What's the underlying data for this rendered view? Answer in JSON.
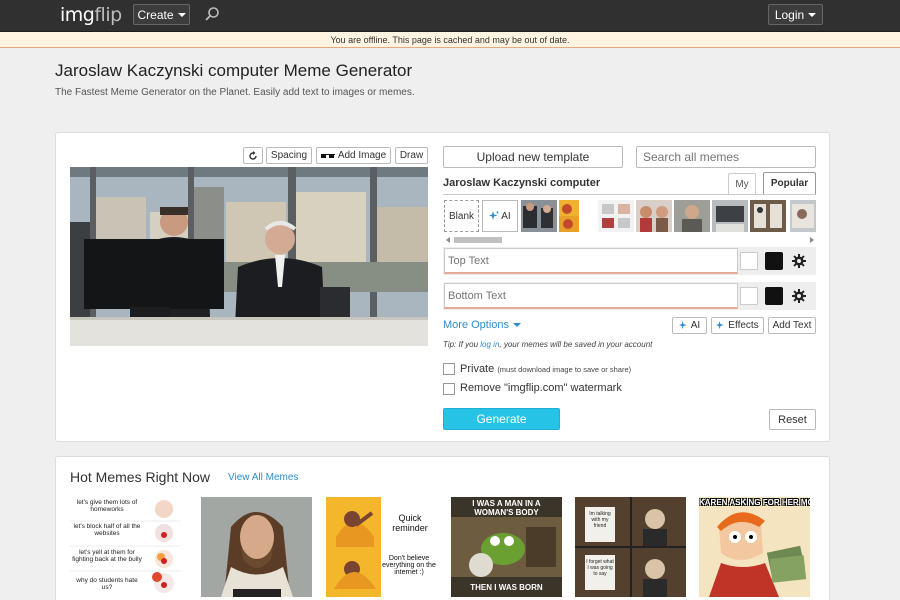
{
  "topbar": {
    "logo_primary": "img",
    "logo_secondary": "flip",
    "create_label": "Create",
    "login_label": "Login"
  },
  "offline_banner": "You are offline. This page is cached and may be out of date.",
  "page": {
    "title": "Jaroslaw Kaczynski computer Meme Generator",
    "subtitle": "The Fastest Meme Generator on the Planet. Easily add text to images or memes."
  },
  "toolbar": {
    "rotate_icon": "rotate-icon",
    "spacing_label": "Spacing",
    "add_image_label": "Add Image",
    "draw_label": "Draw"
  },
  "editor": {
    "upload_label": "Upload new template",
    "search_placeholder": "Search all memes",
    "template_name": "Jaroslaw Kaczynski computer",
    "tab_my": "My",
    "tab_popular": "Popular",
    "blank_label": "Blank",
    "ai_label": "AI",
    "top_text_placeholder": "Top Text",
    "bottom_text_placeholder": "Bottom Text",
    "more_options_label": "More Options",
    "ai_button_label": "AI",
    "effects_label": "Effects",
    "add_text_label": "Add Text",
    "tip_prefix": "Tip: If you ",
    "tip_link": "log in",
    "tip_suffix": ", your memes will be saved in your account",
    "private_label": "Private",
    "private_note": "(must download image to save or share)",
    "watermark_label": "Remove \"imgflip.com\" watermark",
    "generate_label": "Generate",
    "reset_label": "Reset",
    "swatch_colors": {
      "white": "#ffffff",
      "black": "#111111"
    }
  },
  "hot_memes": {
    "title": "Hot Memes Right Now",
    "view_all": "View All Memes",
    "items": [
      {
        "name": "clown",
        "captions": [
          "let's give them lots of homeworks",
          "let's block half of all the websites",
          "let's yell at them for fighting back at the bully",
          "why do students hate us?"
        ]
      },
      {
        "name": "jesus"
      },
      {
        "name": "drake",
        "captions": [
          "Quick reminder",
          "Don't believe everything on the internet :)"
        ]
      },
      {
        "name": "kermit",
        "captions": [
          "I WAS A MAN IN A WOMAN'S BODY",
          "THEN I WAS BORN"
        ]
      },
      {
        "name": "gru",
        "captions": [
          "Im talking with my friend",
          "I forget what I was going to say"
        ]
      },
      {
        "name": "fry",
        "captions": [
          "KAREN ASKING FOR HER MO"
        ]
      }
    ]
  },
  "colors": {
    "accent_blue": "#2f8ccc",
    "generate": "#27c3e6",
    "topbar": "#303030"
  }
}
